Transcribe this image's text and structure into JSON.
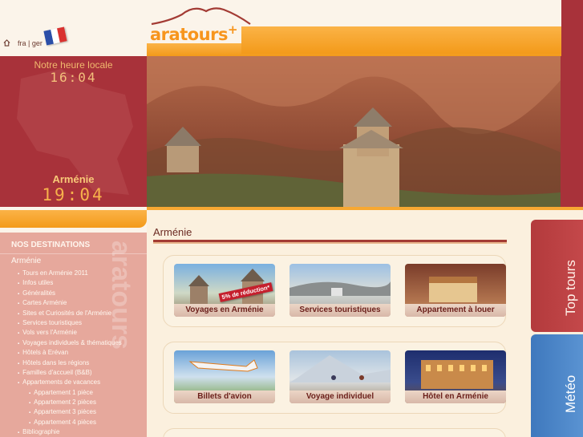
{
  "header": {
    "logo_text": "aratours",
    "logo_plus": "+"
  },
  "topbar": {
    "lang_fr": "fra",
    "lang_sep": "|",
    "lang_de": "ger"
  },
  "clock": {
    "local_label": "Notre heure locale",
    "local_time": "16:04",
    "armenia_label": "Arménie",
    "armenia_time": "19:04"
  },
  "nav": {
    "title": "NOS DESTINATIONS",
    "current": "Arménie",
    "watermark": "aratours",
    "items": [
      {
        "label": "Tours en Arménie 2011",
        "sub": false
      },
      {
        "label": "Infos utiles",
        "sub": false
      },
      {
        "label": "Généralités",
        "sub": false
      },
      {
        "label": "Cartes Arménie",
        "sub": false
      },
      {
        "label": "Sites et Curiosités de l'Arménie",
        "sub": false
      },
      {
        "label": "Services touristiques",
        "sub": false
      },
      {
        "label": "Vols vers l'Arménie",
        "sub": false
      },
      {
        "label": "Voyages individuels & thématiques",
        "sub": false
      },
      {
        "label": "Hôtels à Erévan",
        "sub": false
      },
      {
        "label": "Hôtels dans les régions",
        "sub": false
      },
      {
        "label": "Familles d'accueil (B&B)",
        "sub": false
      },
      {
        "label": "Appartements de vacances",
        "sub": false
      },
      {
        "label": "Appartement 1 pièce",
        "sub": true
      },
      {
        "label": "Appartement 2 pièces",
        "sub": true
      },
      {
        "label": "Appartement 3 pièces",
        "sub": true
      },
      {
        "label": "Appartement 4 pièces",
        "sub": true
      },
      {
        "label": "Bibliographie",
        "sub": false
      }
    ]
  },
  "main": {
    "title": "Arménie",
    "cards_row1": [
      {
        "label": "Voyages en Arménie",
        "promo": "5% de réduction*"
      },
      {
        "label": "Services touristiques"
      },
      {
        "label": "Appartement à louer"
      }
    ],
    "cards_row2": [
      {
        "label": "Billets d'avion"
      },
      {
        "label": "Voyage individuel"
      },
      {
        "label": "Hôtel en Arménie"
      }
    ]
  },
  "tabs": {
    "top_tours": "Top tours",
    "meteo": "Météo"
  },
  "colors": {
    "orange": "#f39a1a",
    "burgundy": "#a8323a",
    "meteo_blue": "#3e78bd"
  }
}
